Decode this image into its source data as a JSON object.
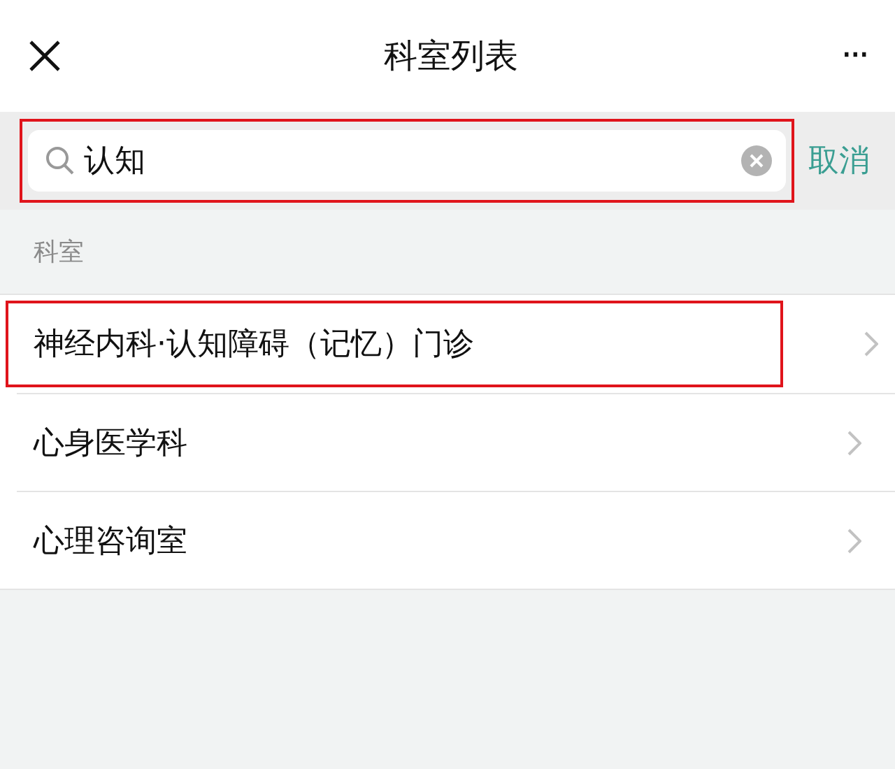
{
  "header": {
    "title": "科室列表",
    "more": "···"
  },
  "search": {
    "value": "认知",
    "highlighted": true,
    "cancel": "取消"
  },
  "section": {
    "label": "科室"
  },
  "rows": [
    {
      "label": "神经内科·认知障碍（记忆）门诊",
      "highlighted": true
    },
    {
      "label": "心身医学科",
      "highlighted": false
    },
    {
      "label": "心理咨询室",
      "highlighted": false
    }
  ]
}
